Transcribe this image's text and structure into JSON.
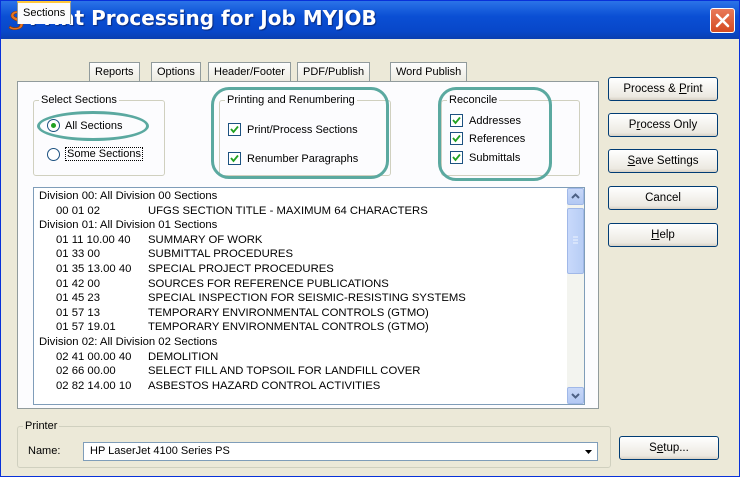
{
  "window": {
    "title": "Print Processing for Job MYJOB"
  },
  "tabs": [
    "Sections",
    "Reports",
    "Options",
    "Header/Footer",
    "PDF/Publish",
    "Word Publish"
  ],
  "select_sections": {
    "legend": "Select Sections",
    "all": "All Sections",
    "some": "Some Sections",
    "selected": "All Sections"
  },
  "printing": {
    "legend": "Printing and Renumbering",
    "process": {
      "label": "Print/Process Sections",
      "checked": true
    },
    "renumber": {
      "label": "Renumber Paragraphs",
      "checked": true
    }
  },
  "reconcile": {
    "legend": "Reconcile",
    "addresses": {
      "label": "Addresses",
      "checked": true
    },
    "references": {
      "label": "References",
      "checked": true
    },
    "submittals": {
      "label": "Submittals",
      "checked": true
    }
  },
  "sections_list": [
    {
      "division": "Division 00: All Division 00 Sections"
    },
    {
      "num": "00 01 02",
      "title": "UFGS SECTION TITLE - MAXIMUM 64 CHARACTERS"
    },
    {
      "division": "Division 01: All Division 01 Sections"
    },
    {
      "num": "01 11 10.00 40",
      "title": "SUMMARY OF WORK"
    },
    {
      "num": "01 33 00",
      "title": "SUBMITTAL PROCEDURES"
    },
    {
      "num": "01 35 13.00 40",
      "title": "SPECIAL PROJECT PROCEDURES"
    },
    {
      "num": "01 42 00",
      "title": "SOURCES FOR REFERENCE PUBLICATIONS"
    },
    {
      "num": "01 45 23",
      "title": "SPECIAL INSPECTION FOR SEISMIC-RESISTING SYSTEMS"
    },
    {
      "num": "01 57 13",
      "title": "TEMPORARY ENVIRONMENTAL CONTROLS (GTMO)"
    },
    {
      "num": "01 57 19.01",
      "title": "TEMPORARY ENVIRONMENTAL CONTROLS (GTMO)"
    },
    {
      "division": "Division 02: All Division 02 Sections"
    },
    {
      "num": "02 41 00.00 40",
      "title": "DEMOLITION"
    },
    {
      "num": "02 66 00.00",
      "title": "SELECT FILL AND TOPSOIL FOR LANDFILL COVER"
    },
    {
      "num": "02 82 14.00 10",
      "title": "ASBESTOS HAZARD CONTROL ACTIVITIES"
    }
  ],
  "buttons": {
    "process_print": {
      "pre": "Process & ",
      "acc": "P",
      "post": "rint"
    },
    "process_only": {
      "pre": "P",
      "acc": "r",
      "post": "ocess Only"
    },
    "save_settings": {
      "pre": "",
      "acc": "S",
      "post": "ave Settings"
    },
    "cancel": {
      "pre": "Cancel",
      "acc": "",
      "post": ""
    },
    "help": {
      "pre": "",
      "acc": "H",
      "post": "elp"
    }
  },
  "printer": {
    "legend": "Printer",
    "name_label": "Name:",
    "name_value": "HP LaserJet 4100 Series PS",
    "setup": {
      "pre": "S",
      "acc": "e",
      "post": "tup..."
    }
  },
  "colors": {
    "titlebar": "#0a4fd4",
    "highlight": "#5ba9a0",
    "close": "#d54b22"
  }
}
